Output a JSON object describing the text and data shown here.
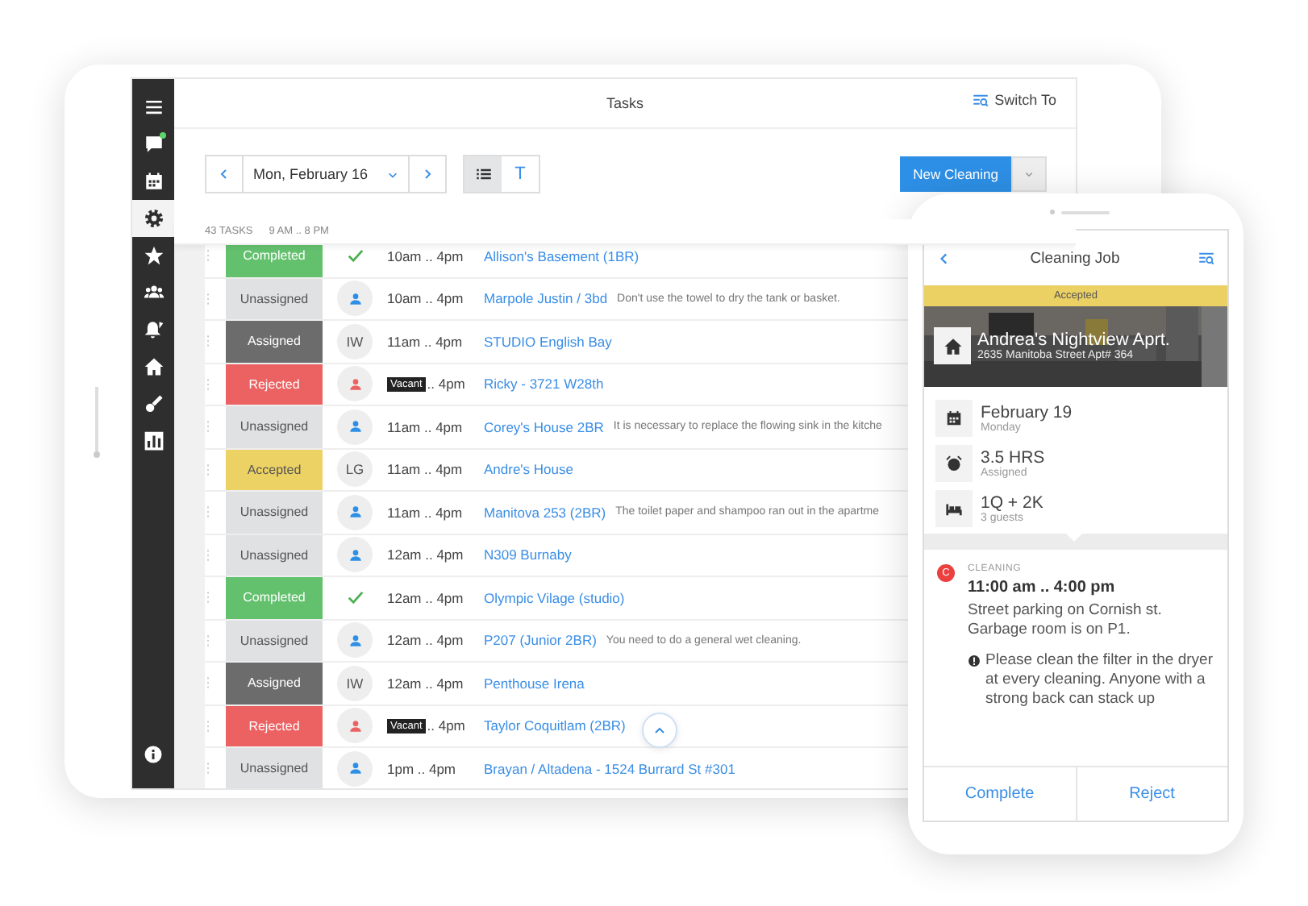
{
  "tablet": {
    "sidebar": {
      "items": [
        {
          "kind": "menu",
          "selected": false,
          "notification": false
        },
        {
          "kind": "chat",
          "selected": false,
          "notification": true
        },
        {
          "kind": "calendar",
          "selected": false,
          "notification": false
        },
        {
          "kind": "gear",
          "selected": true,
          "notification": false
        },
        {
          "kind": "star",
          "selected": false,
          "notification": false
        },
        {
          "kind": "group",
          "selected": false,
          "notification": false
        },
        {
          "kind": "bell",
          "selected": false,
          "notification": false
        },
        {
          "kind": "home",
          "selected": false,
          "notification": false
        },
        {
          "kind": "brush",
          "selected": false,
          "notification": false
        },
        {
          "kind": "chart",
          "selected": false,
          "notification": false
        }
      ],
      "footer": {
        "kind": "info"
      }
    },
    "header": {
      "title": "Tasks",
      "switch_button": "Switch To"
    },
    "toolbar": {
      "date": "Mon, February 16",
      "view_toggle": [
        {
          "kind": "list",
          "selected": true
        },
        {
          "kind": "text",
          "label": "T",
          "selected": false
        }
      ],
      "new_button": "New Cleaning"
    },
    "summary": {
      "count": "43 TASKS",
      "hours": "9 AM .. 8 PM"
    },
    "rows": [
      {
        "status": {
          "label": "Completed",
          "color": "#63c16e"
        },
        "avatar": {
          "kind": "done"
        },
        "time": "10am .. 4pm",
        "title": "Allison's Basement (1BR)"
      },
      {
        "status": {
          "label": "Unassigned",
          "color": "#dfe1e3"
        },
        "avatar": {
          "kind": "open"
        },
        "time": "10am .. 4pm",
        "title": "Marpole Justin / 3bd",
        "note": "Don't use the towel to dry the tank or basket."
      },
      {
        "status": {
          "label": "Assigned",
          "color": "#6c6c6c"
        },
        "avatar": {
          "kind": "initials",
          "initials": "IW"
        },
        "time": "11am .. 4pm",
        "title": "STUDIO English Bay"
      },
      {
        "status": {
          "label": "Rejected",
          "color": "#ec6262"
        },
        "avatar": {
          "kind": "rejected"
        },
        "vacant": "Vacant",
        "time": ".. 4pm",
        "title": "Ricky - 3721 W28th"
      },
      {
        "status": {
          "label": "Unassigned",
          "color": "#dfe1e3"
        },
        "avatar": {
          "kind": "open"
        },
        "time": "11am .. 4pm",
        "title": "Corey's House 2BR",
        "note": "It is necessary to replace the flowing sink in the kitche"
      },
      {
        "status": {
          "label": "Accepted",
          "color": "#ecd164"
        },
        "avatar": {
          "kind": "initials",
          "initials": "LG"
        },
        "time": "11am .. 4pm",
        "title": "Andre's House"
      },
      {
        "status": {
          "label": "Unassigned",
          "color": "#dfe1e3"
        },
        "avatar": {
          "kind": "open"
        },
        "time": "11am .. 4pm",
        "title": "Manitova 253 (2BR)",
        "note": "The toilet paper and shampoo ran out in the apartme"
      },
      {
        "status": {
          "label": "Unassigned",
          "color": "#dfe1e3"
        },
        "avatar": {
          "kind": "open"
        },
        "time": "12am .. 4pm",
        "title": "N309 Burnaby"
      },
      {
        "status": {
          "label": "Completed",
          "color": "#63c16e"
        },
        "avatar": {
          "kind": "done"
        },
        "time": "12am .. 4pm",
        "title": "Olympic Vilage (studio)"
      },
      {
        "status": {
          "label": "Unassigned",
          "color": "#dfe1e3"
        },
        "avatar": {
          "kind": "open"
        },
        "time": "12am .. 4pm",
        "title": "P207 (Junior 2BR)",
        "note": "You need to do a general wet cleaning."
      },
      {
        "status": {
          "label": "Assigned",
          "color": "#6c6c6c"
        },
        "avatar": {
          "kind": "initials",
          "initials": "IW"
        },
        "time": "12am .. 4pm",
        "title": "Penthouse Irena"
      },
      {
        "status": {
          "label": "Rejected",
          "color": "#ec6262"
        },
        "avatar": {
          "kind": "rejected"
        },
        "vacant": "Vacant",
        "time": ".. 4pm",
        "title": "Taylor Coquitlam (2BR)"
      },
      {
        "status": {
          "label": "Unassigned",
          "color": "#dfe1e3"
        },
        "avatar": {
          "kind": "open"
        },
        "time": "1pm .. 4pm",
        "title": "Brayan / Altadena - 1524 Burrard St #301"
      }
    ]
  },
  "phone": {
    "header": {
      "title": "Cleaning Job"
    },
    "status": "Accepted",
    "property": {
      "name": "Andrea's Nightview Aprt.",
      "address": "2635 Manitoba Street Apt# 364"
    },
    "details": [
      {
        "kind": "calendar",
        "main": "February 19",
        "sub": "Monday"
      },
      {
        "kind": "alarm",
        "main": "3.5 HRS",
        "sub": "Assigned"
      },
      {
        "kind": "bed",
        "main": "1Q + 2K",
        "sub": "3 guests"
      }
    ],
    "note": {
      "badge": "C",
      "category": "CLEANING",
      "time": "11:00 am .. 4:00 pm",
      "text": "Street parking on Cornish st. Garbage room is on P1.",
      "warning": "Please  clean the filter in the dryer at every cleaning. Anyone with a strong back can stack up"
    },
    "actions": [
      "Complete",
      "Reject"
    ]
  }
}
